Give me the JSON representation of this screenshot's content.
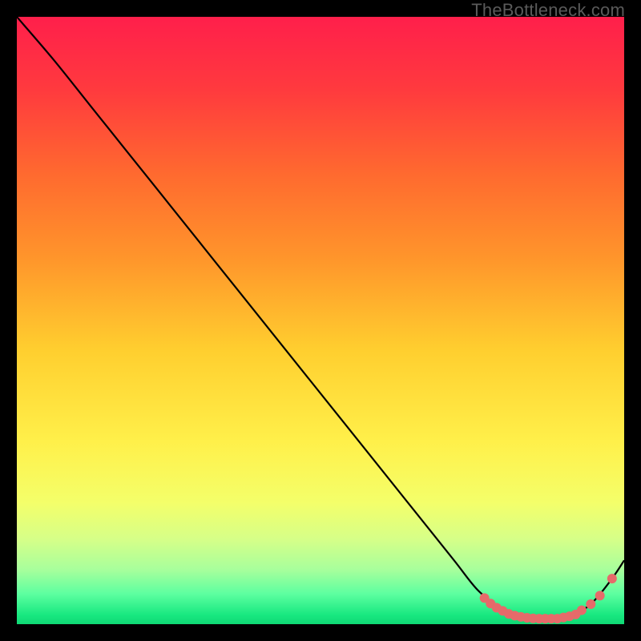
{
  "watermark": "TheBottleneck.com",
  "chart_data": {
    "type": "line",
    "title": "",
    "xlabel": "",
    "ylabel": "",
    "xlim": [
      0,
      100
    ],
    "ylim": [
      0,
      100
    ],
    "grid": false,
    "series": [
      {
        "name": "curve",
        "x": [
          0,
          6,
          12,
          18,
          24,
          30,
          36,
          42,
          48,
          54,
          60,
          66,
          72,
          76,
          80,
          83,
          86,
          89,
          92,
          95,
          98,
          100
        ],
        "y": [
          100,
          93,
          85.5,
          78,
          70.5,
          63,
          55.5,
          48,
          40.5,
          33,
          25.5,
          18,
          10.5,
          5.5,
          2.5,
          1.2,
          0.9,
          0.9,
          1.6,
          3.8,
          7.5,
          10.5
        ]
      }
    ],
    "markers": {
      "name": "highlight-dots",
      "x": [
        77,
        78,
        79,
        80,
        81,
        82,
        83,
        84,
        85,
        86,
        87,
        88,
        89,
        90,
        91,
        92,
        93,
        94.5,
        96,
        98
      ],
      "y": [
        4.3,
        3.4,
        2.7,
        2.2,
        1.7,
        1.4,
        1.2,
        1.05,
        0.95,
        0.9,
        0.9,
        0.9,
        0.9,
        1.1,
        1.3,
        1.6,
        2.3,
        3.3,
        4.7,
        7.5
      ]
    },
    "dot_radius": 6,
    "dot_color": "#e66a6a",
    "line_color": "#000000",
    "bg_gradient_stops": [
      {
        "offset": 0.0,
        "color": "#ff1f4b"
      },
      {
        "offset": 0.12,
        "color": "#ff3a3e"
      },
      {
        "offset": 0.26,
        "color": "#ff6a2f"
      },
      {
        "offset": 0.4,
        "color": "#ff962b"
      },
      {
        "offset": 0.55,
        "color": "#ffcf2f"
      },
      {
        "offset": 0.7,
        "color": "#fff04a"
      },
      {
        "offset": 0.8,
        "color": "#f4ff6a"
      },
      {
        "offset": 0.86,
        "color": "#d6ff88"
      },
      {
        "offset": 0.91,
        "color": "#a8ff9c"
      },
      {
        "offset": 0.95,
        "color": "#5dffa0"
      },
      {
        "offset": 0.985,
        "color": "#18e880"
      },
      {
        "offset": 1.0,
        "color": "#0fd874"
      }
    ]
  }
}
